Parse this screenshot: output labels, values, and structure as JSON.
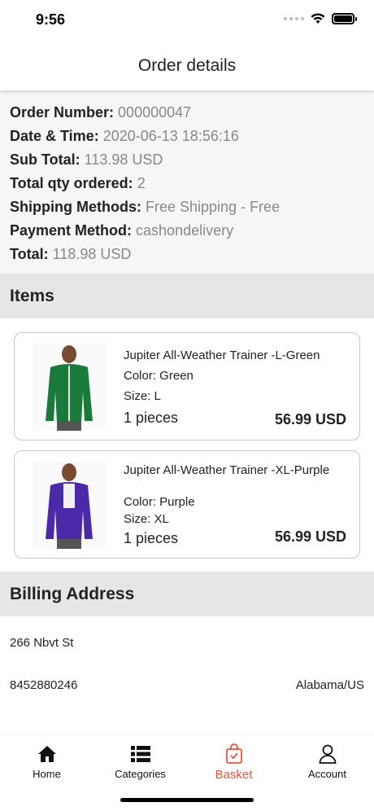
{
  "status_bar": {
    "time": "9:56"
  },
  "header": {
    "title": "Order details"
  },
  "order": {
    "number_label": "Order Number:",
    "number_value": "000000047",
    "date_label": "Date & Time:",
    "date_value": "2020-06-13 18:56:16",
    "subtotal_label": "Sub Total:",
    "subtotal_value": "113.98 USD",
    "qty_label": "Total qty ordered:",
    "qty_value": "2",
    "shipping_label": "Shipping Methods:",
    "shipping_value": "Free Shipping - Free",
    "payment_label": "Payment Method:",
    "payment_value": "cashondelivery",
    "total_label": "Total:",
    "total_value": "118.98 USD"
  },
  "items_section": {
    "title": "Items"
  },
  "items": [
    {
      "name": "Jupiter All-Weather Trainer -L-Green",
      "color": "Color: Green",
      "size": "Size: L",
      "qty": "1 pieces",
      "price": "56.99 USD",
      "jacket_color": "#1a7a3a"
    },
    {
      "name": "Jupiter All-Weather Trainer -XL-Purple",
      "color": "Color: Purple",
      "size": "Size: XL",
      "qty": "1 pieces",
      "price": "56.99 USD",
      "jacket_color": "#4a2aa8"
    }
  ],
  "billing_section": {
    "title": "Billing Address"
  },
  "billing": {
    "street": "266 Nbvt St",
    "phone": "8452880246",
    "region": "Alabama/US"
  },
  "tabs": [
    {
      "label": "Home",
      "icon": "home-icon"
    },
    {
      "label": "Categories",
      "icon": "list-icon"
    },
    {
      "label": "Basket",
      "icon": "basket-icon",
      "active": true
    },
    {
      "label": "Account",
      "icon": "user-icon"
    }
  ],
  "colors": {
    "accent": "#e8553f",
    "section_bg": "#e6e6e6"
  }
}
